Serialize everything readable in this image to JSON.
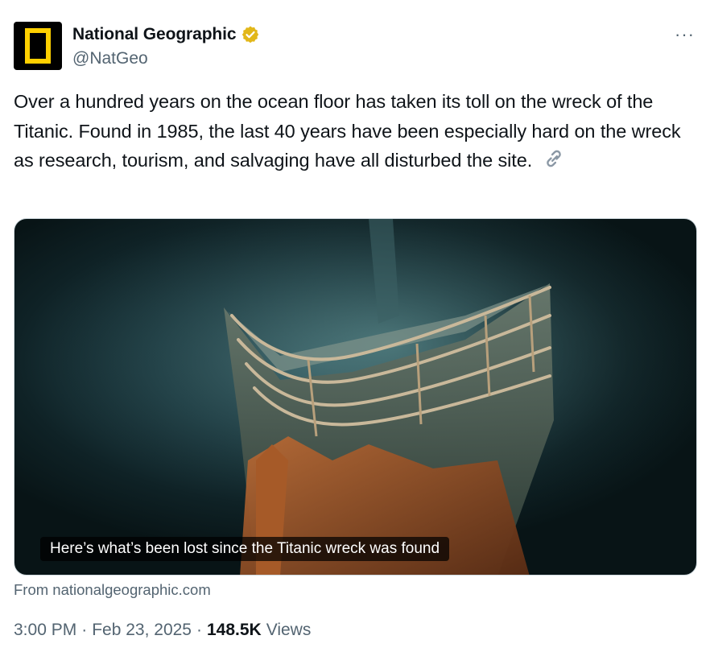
{
  "author": {
    "display_name": "National Geographic",
    "handle": "@NatGeo",
    "verified_icon": "verified-gold-badge",
    "avatar_icon": "natgeo-yellow-frame-logo",
    "more_label": "···"
  },
  "tweet": {
    "text": "Over a hundred years on the ocean floor has taken its toll on the wreck of the Titanic. Found in 1985, the last 40 years have been especially hard on the wreck as research, tourism, and salvaging have all disturbed the site.",
    "link_icon": "link-icon"
  },
  "card": {
    "image_description_icon": "titanic-bow-wreck-photo",
    "caption": "Here’s what’s been lost since the Titanic wreck was found",
    "source": "From nationalgeographic.com"
  },
  "meta": {
    "time": "3:00 PM",
    "separator": "·",
    "date": "Feb 23, 2025",
    "views_count": "148.5K",
    "views_label": "Views"
  },
  "colors": {
    "text_primary": "#0f1419",
    "text_secondary": "#536471",
    "natgeo_yellow": "#ffd000",
    "verified_gold": "#e2b719"
  }
}
